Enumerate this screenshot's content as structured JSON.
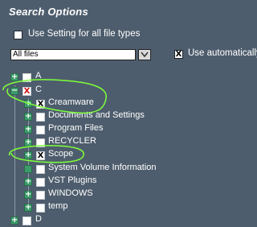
{
  "header": {
    "title": "Search Options",
    "use_setting_label": "Use Setting for all file types",
    "use_setting_checked": false
  },
  "filter": {
    "selected": "All files",
    "use_auto_label": "Use automatically",
    "use_auto_checked": true
  },
  "tree": [
    {
      "label": "A",
      "mark": ""
    },
    {
      "label": "C",
      "mark": "X",
      "mark_color": "#d11111",
      "expanded": true
    },
    {
      "label": "Creamware",
      "mark": "X"
    },
    {
      "label": "Documents and Settings",
      "mark": ""
    },
    {
      "label": "Program Files",
      "mark": ""
    },
    {
      "label": "RECYCLER",
      "mark": ""
    },
    {
      "label": "Scope",
      "mark": "X"
    },
    {
      "label": "System Volume Information",
      "mark": ""
    },
    {
      "label": "VST Plugins",
      "mark": ""
    },
    {
      "label": "WINDOWS",
      "mark": ""
    },
    {
      "label": "temp",
      "mark": ""
    },
    {
      "label": "D",
      "mark": ""
    }
  ],
  "colors": {
    "background": "#4e5d6d",
    "expander": "#3c9b6a",
    "annotation": "#7dff3a"
  },
  "icons": {
    "plus": "+",
    "minus": "−",
    "dropdown": "chevron-down-icon"
  }
}
